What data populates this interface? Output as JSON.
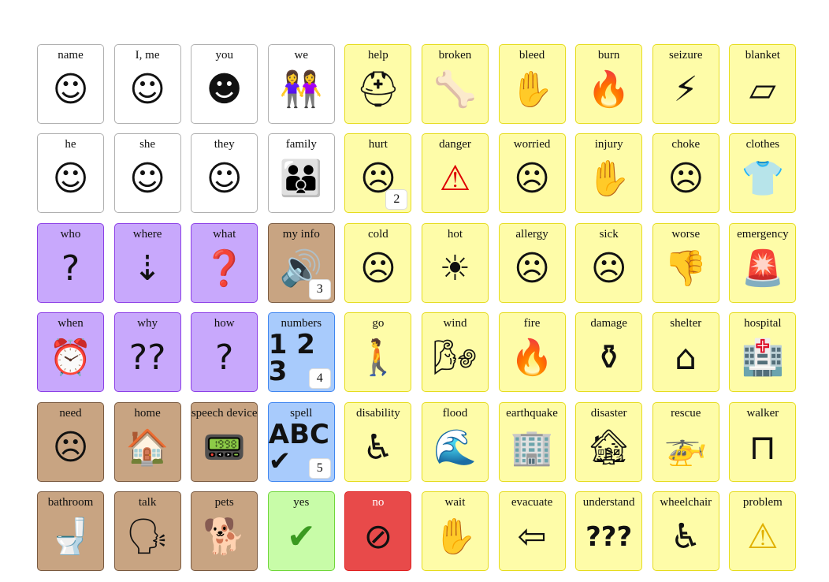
{
  "colors": {
    "white": "#ffffff",
    "yellow": "#fefca8",
    "purple": "#c8a8fc",
    "brown": "#c8a482",
    "blue": "#a8cbfc",
    "green": "#c8fca8",
    "red": "#e84a4a"
  },
  "cells": [
    {
      "label": "name",
      "type": "white",
      "icon": "name-person-icon",
      "glyph": "☺"
    },
    {
      "label": "I, me",
      "type": "white",
      "icon": "self-person-icon",
      "glyph": "☺"
    },
    {
      "label": "you",
      "type": "white",
      "icon": "point-you-icon",
      "glyph": "☻"
    },
    {
      "label": "we",
      "type": "white",
      "icon": "two-people-icon",
      "glyph": "👭"
    },
    {
      "label": "help",
      "type": "yellow",
      "icon": "help-icon",
      "glyph": "⛑"
    },
    {
      "label": "broken",
      "type": "yellow",
      "icon": "broken-bone-icon",
      "glyph": "🦴"
    },
    {
      "label": "bleed",
      "type": "yellow",
      "icon": "bleeding-hand-icon",
      "glyph": "✋"
    },
    {
      "label": "burn",
      "type": "yellow",
      "icon": "burn-icon",
      "glyph": "🔥"
    },
    {
      "label": "seizure",
      "type": "yellow",
      "icon": "seizure-icon",
      "glyph": "⚡"
    },
    {
      "label": "blanket",
      "type": "yellow",
      "icon": "blanket-icon",
      "glyph": "▱"
    },
    {
      "label": "he",
      "type": "white",
      "icon": "he-icon",
      "glyph": "☺"
    },
    {
      "label": "she",
      "type": "white",
      "icon": "she-icon",
      "glyph": "☺"
    },
    {
      "label": "they",
      "type": "white",
      "icon": "they-icon",
      "glyph": "☺"
    },
    {
      "label": "family",
      "type": "white",
      "icon": "family-icon",
      "glyph": "👪"
    },
    {
      "label": "hurt",
      "type": "yellow",
      "icon": "hurt-icon",
      "glyph": "☹",
      "badge": "2"
    },
    {
      "label": "danger",
      "type": "yellow",
      "icon": "warning-triangle-icon",
      "glyph": "⚠"
    },
    {
      "label": "worried",
      "type": "yellow",
      "icon": "worried-icon",
      "glyph": "☹"
    },
    {
      "label": "injury",
      "type": "yellow",
      "icon": "injury-icon",
      "glyph": "✋"
    },
    {
      "label": "choke",
      "type": "yellow",
      "icon": "choke-icon",
      "glyph": "☹"
    },
    {
      "label": "clothes",
      "type": "yellow",
      "icon": "clothes-icon",
      "glyph": "👕"
    },
    {
      "label": "who",
      "type": "purple",
      "icon": "who-icon",
      "glyph": "?"
    },
    {
      "label": "where",
      "type": "purple",
      "icon": "where-arrows-icon",
      "glyph": "⇣"
    },
    {
      "label": "what",
      "type": "purple",
      "icon": "question-red-icon",
      "glyph": "❓"
    },
    {
      "label": "my info",
      "type": "brown",
      "icon": "speaker-icon",
      "glyph": "🔊",
      "badge": "3"
    },
    {
      "label": "cold",
      "type": "yellow",
      "icon": "cold-icon",
      "glyph": "☹"
    },
    {
      "label": "hot",
      "type": "yellow",
      "icon": "hot-icon",
      "glyph": "☀"
    },
    {
      "label": "allergy",
      "type": "yellow",
      "icon": "allergy-icon",
      "glyph": "☹"
    },
    {
      "label": "sick",
      "type": "yellow",
      "icon": "sick-icon",
      "glyph": "☹"
    },
    {
      "label": "worse",
      "type": "yellow",
      "icon": "thumbs-down-icon",
      "glyph": "👎"
    },
    {
      "label": "emergency",
      "type": "yellow",
      "icon": "siren-icon",
      "glyph": "🚨"
    },
    {
      "label": "when",
      "type": "purple",
      "icon": "clock-question-icon",
      "glyph": "⏰"
    },
    {
      "label": "why",
      "type": "purple",
      "icon": "question-marks-icon",
      "glyph": "??"
    },
    {
      "label": "how",
      "type": "purple",
      "icon": "how-question-icon",
      "glyph": "?"
    },
    {
      "label": "numbers",
      "type": "blue",
      "icon": "numbers-icon",
      "glyph": "1 2 3",
      "badge": "4"
    },
    {
      "label": "go",
      "type": "yellow",
      "icon": "walking-icon",
      "glyph": "🚶"
    },
    {
      "label": "wind",
      "type": "yellow",
      "icon": "wind-icon",
      "glyph": "🌬"
    },
    {
      "label": "fire",
      "type": "yellow",
      "icon": "fire-icon",
      "glyph": "🔥"
    },
    {
      "label": "damage",
      "type": "yellow",
      "icon": "broken-vase-icon",
      "glyph": "⚱"
    },
    {
      "label": "shelter",
      "type": "yellow",
      "icon": "shelter-icon",
      "glyph": "⌂"
    },
    {
      "label": "hospital",
      "type": "yellow",
      "icon": "hospital-icon",
      "glyph": "🏥"
    },
    {
      "label": "need",
      "type": "brown",
      "icon": "need-icon",
      "glyph": "☹"
    },
    {
      "label": "home",
      "type": "brown",
      "icon": "house-icon",
      "glyph": "🏠"
    },
    {
      "label": "speech device",
      "type": "brown",
      "icon": "speech-device-icon",
      "glyph": "📟"
    },
    {
      "label": "spell",
      "type": "blue",
      "icon": "abc-check-icon",
      "glyph": "ABC ✔",
      "badge": "5"
    },
    {
      "label": "disability",
      "type": "yellow",
      "icon": "wheelchair-user-icon",
      "glyph": "♿"
    },
    {
      "label": "flood",
      "type": "yellow",
      "icon": "flood-icon",
      "glyph": "🌊"
    },
    {
      "label": "earthquake",
      "type": "yellow",
      "icon": "earthquake-icon",
      "glyph": "🏢"
    },
    {
      "label": "disaster",
      "type": "yellow",
      "icon": "disaster-icon",
      "glyph": "🏚"
    },
    {
      "label": "rescue",
      "type": "yellow",
      "icon": "helicopter-icon",
      "glyph": "🚁"
    },
    {
      "label": "walker",
      "type": "yellow",
      "icon": "walker-icon",
      "glyph": "⊓"
    },
    {
      "label": "bathroom",
      "type": "brown",
      "icon": "toilet-icon",
      "glyph": "🚽"
    },
    {
      "label": "talk",
      "type": "brown",
      "icon": "talk-icon",
      "glyph": "🗣"
    },
    {
      "label": "pets",
      "type": "brown",
      "icon": "pets-icon",
      "glyph": "🐕"
    },
    {
      "label": "yes",
      "type": "green",
      "icon": "checkmark-icon",
      "glyph": "✔"
    },
    {
      "label": "no",
      "type": "red",
      "icon": "no-sign-icon",
      "glyph": "⊘"
    },
    {
      "label": "wait",
      "type": "yellow",
      "icon": "wait-hand-icon",
      "glyph": "✋"
    },
    {
      "label": "evacuate",
      "type": "yellow",
      "icon": "exit-arrow-icon",
      "glyph": "⇦"
    },
    {
      "label": "understand",
      "type": "yellow",
      "icon": "confused-icon",
      "glyph": "???"
    },
    {
      "label": "wheelchair",
      "type": "yellow",
      "icon": "wheelchair-icon",
      "glyph": "♿"
    },
    {
      "label": "problem",
      "type": "yellow",
      "icon": "warning-icon",
      "glyph": "⚠"
    }
  ]
}
